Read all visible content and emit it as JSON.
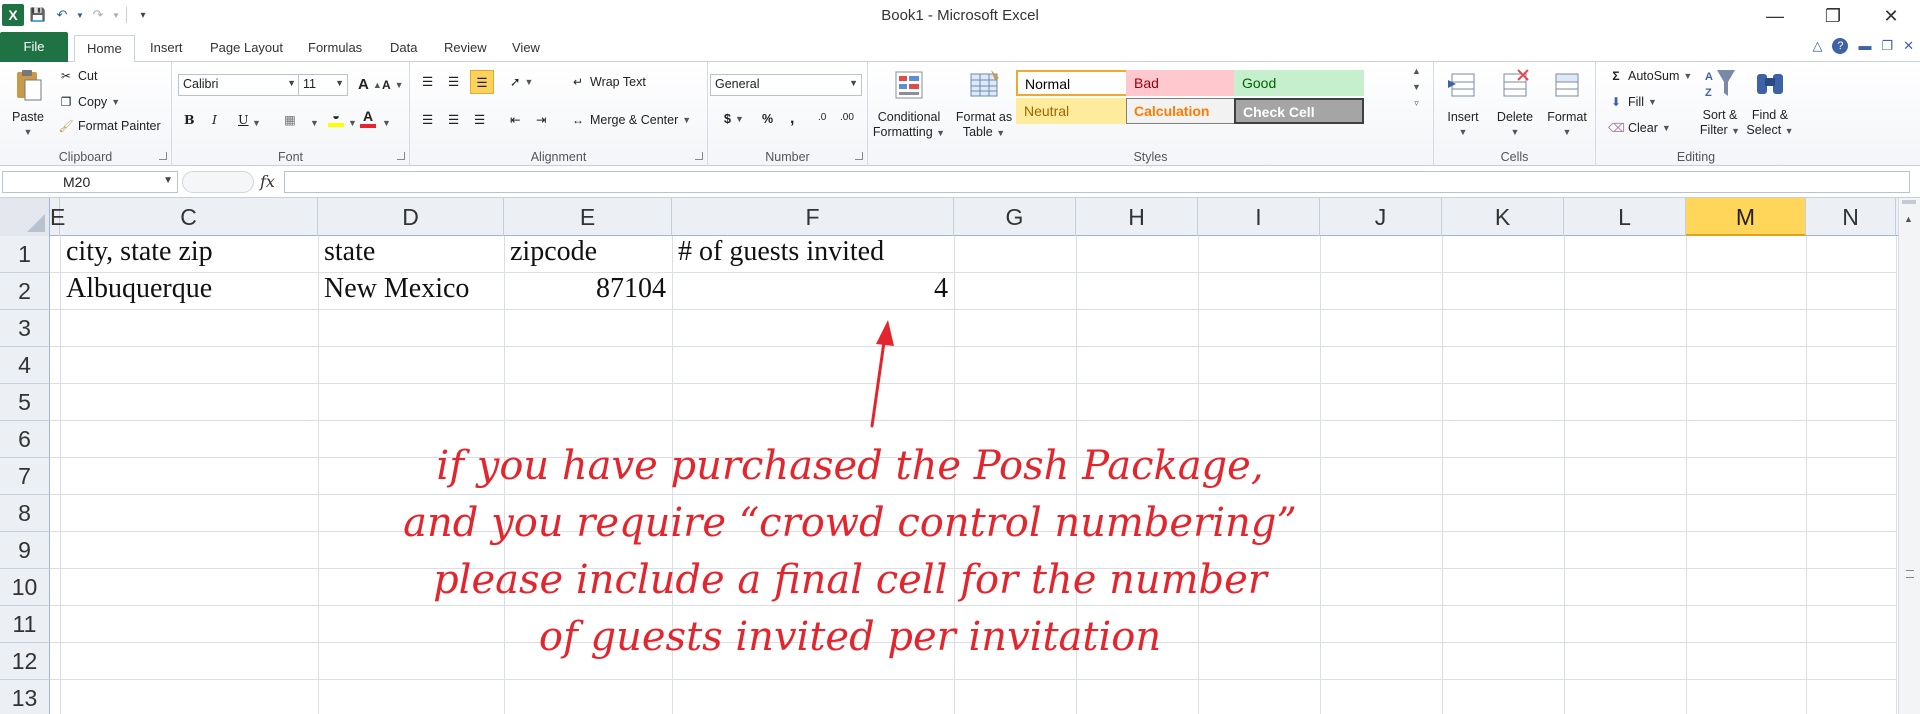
{
  "app": {
    "logo": "X",
    "title": "Book1 - Microsoft Excel"
  },
  "qat": {
    "icons": [
      "excel-logo",
      "save-icon",
      "undo-icon",
      "redo-icon",
      "customize-icon"
    ]
  },
  "tabs": [
    "File",
    "Home",
    "Insert",
    "Page Layout",
    "Formulas",
    "Data",
    "Review",
    "View"
  ],
  "ribbon": {
    "clipboard": {
      "paste": "Paste",
      "cut": "Cut",
      "copy": "Copy",
      "format_painter": "Format Painter",
      "label": "Clipboard"
    },
    "font": {
      "name": "Calibri",
      "size": "11",
      "bold": "B",
      "italic": "I",
      "underline": "U",
      "grow": "A",
      "shrink": "A",
      "label": "Font"
    },
    "alignment": {
      "wrap": "Wrap Text",
      "merge": "Merge & Center",
      "label": "Alignment"
    },
    "number": {
      "format": "General",
      "currency": "$",
      "percent": "%",
      "comma": ",",
      "label": "Number"
    },
    "styles": {
      "conditional": [
        "Conditional",
        "Formatting"
      ],
      "format_table": [
        "Format as",
        "Table"
      ],
      "cells": [
        {
          "text": "Normal",
          "bg": "#ffffff",
          "color": "#000000",
          "border": "#f0a830"
        },
        {
          "text": "Bad",
          "bg": "#ffc7ce",
          "color": "#9c0006",
          "border": "#ffc7ce"
        },
        {
          "text": "Good",
          "bg": "#c6efce",
          "color": "#006100",
          "border": "#c6efce"
        },
        {
          "text": "Neutral",
          "bg": "#ffeb9c",
          "color": "#9c6500",
          "border": "#ffeb9c"
        },
        {
          "text": "Calculation",
          "bg": "#f2f2f2",
          "color": "#fa7d00",
          "border": "#7f7f7f"
        },
        {
          "text": "Check Cell",
          "bg": "#a5a5a5",
          "color": "#ffffff",
          "border": "#3f3f3f"
        }
      ],
      "label": "Styles"
    },
    "cells": {
      "insert": "Insert",
      "delete": "Delete",
      "format": "Format",
      "label": "Cells"
    },
    "editing": {
      "autosum": "AutoSum",
      "fill": "Fill",
      "clear": "Clear",
      "sort": [
        "Sort &",
        "Filter"
      ],
      "find": [
        "Find &",
        "Select"
      ],
      "label": "Editing"
    }
  },
  "formula_bar": {
    "name_box": "M20",
    "fx": "fx",
    "value": ""
  },
  "grid": {
    "columns": [
      "E",
      "C",
      "D",
      "E",
      "F",
      "G",
      "H",
      "I",
      "J",
      "K",
      "L",
      "M",
      "N"
    ],
    "selected_column": "M",
    "rows": [
      "1",
      "2",
      "3",
      "4",
      "5",
      "6",
      "7",
      "8",
      "9",
      "10",
      "11",
      "12",
      "13"
    ],
    "cells": {
      "C1": "city, state zip",
      "D1": "state",
      "E1": "zipcode",
      "F1": "# of guests invited",
      "C2": "Albuquerque",
      "D2": "New Mexico",
      "E2": "87104",
      "F2": "4"
    }
  },
  "annotation": {
    "color": "#e3262d",
    "lines": [
      "if you have purchased the Posh Package,",
      "and you require “crowd control numbering”",
      "please include a final cell for the number",
      "of guests invited per invitation"
    ]
  }
}
